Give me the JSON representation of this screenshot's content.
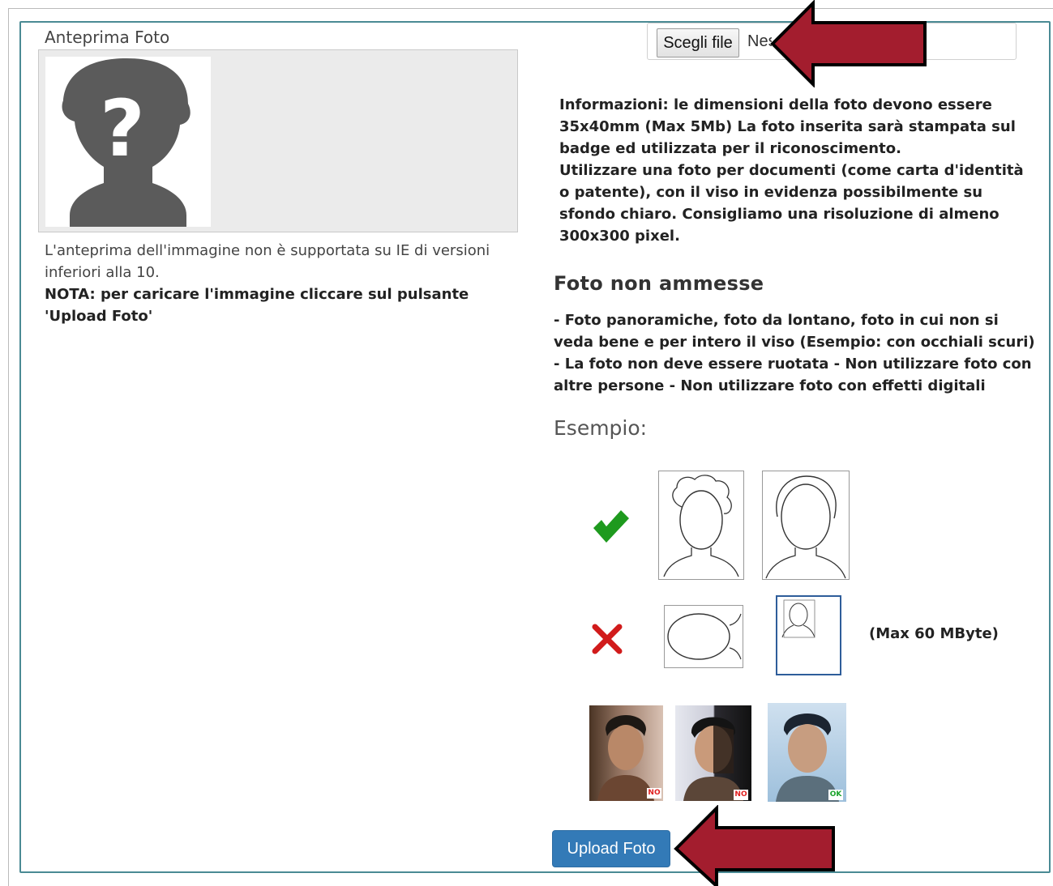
{
  "preview": {
    "label": "Anteprima Foto",
    "note": "L'anteprima dell'immagine non è supportata su IE di versioni inferiori alla 10.",
    "note_bold": "NOTA: per caricare l'immagine cliccare sul pulsante 'Upload Foto'"
  },
  "file_input": {
    "button_label": "Scegli file",
    "status_text": "Nessun file selezionato"
  },
  "info": {
    "line1": "Informazioni: le dimensioni della foto devono essere 35x40mm (Max 5Mb) La foto inserita sarà stampata sul badge ed utilizzata per il riconoscimento.",
    "line2": "Utilizzare una foto per documenti (come carta d'identità o patente), con il viso in evidenza possibilmente su sfondo chiaro. Consigliamo una risoluzione di almeno 300x300 pixel."
  },
  "not_allowed": {
    "heading": "Foto non ammesse",
    "text": "- Foto panoramiche, foto da lontano, foto in cui non si veda bene e per intero il viso (Esempio: con occhiali scuri) - La foto non deve essere ruotata - Non utilizzare foto con altre persone - Non utilizzare foto con effetti digitali"
  },
  "example": {
    "label": "Esempio:",
    "max_size": "(Max 60 MByte)",
    "tags": [
      "NO",
      "NO",
      "OK"
    ],
    "tag_colors": {
      "no": "#e02020",
      "ok": "#1aa32a"
    }
  },
  "upload_button": {
    "label": "Upload Foto"
  },
  "colors": {
    "accent": "#337ab7",
    "arrow": "#a31d2e",
    "check": "#1e9a1e",
    "cross": "#d11b1b"
  }
}
